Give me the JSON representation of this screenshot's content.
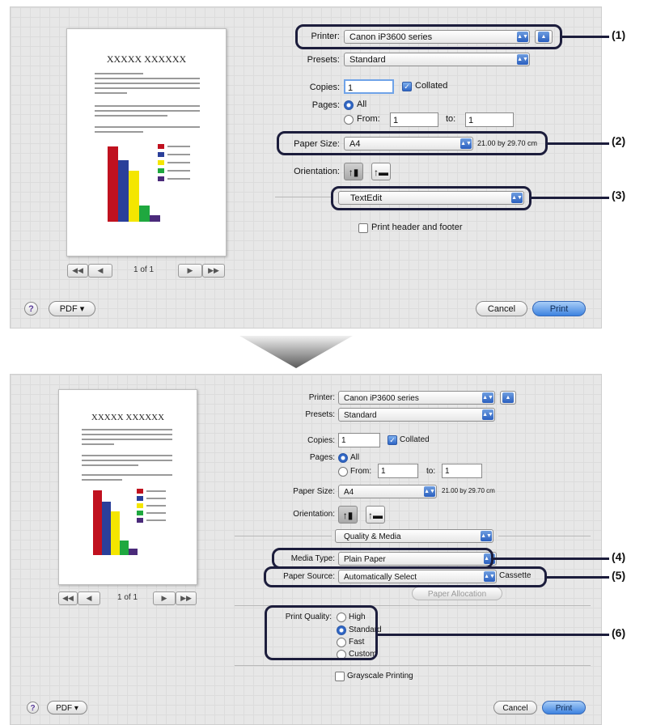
{
  "top": {
    "preview": {
      "doc_title": "XXXXX XXXXXX",
      "page_indicator": "1 of 1",
      "first_label": "◀◀",
      "prev_label": "◀",
      "next_label": "▶",
      "last_label": "▶▶"
    },
    "printer_label": "Printer:",
    "printer_value": "Canon iP3600 series",
    "presets_label": "Presets:",
    "presets_value": "Standard",
    "copies_label": "Copies:",
    "copies_value": "1",
    "collated_label": "Collated",
    "pages_label": "Pages:",
    "all_label": "All",
    "from_label": "From:",
    "from_value": "1",
    "to_label": "to:",
    "to_value": "1",
    "paper_size_label": "Paper Size:",
    "paper_size_value": "A4",
    "paper_dims": "21.00 by 29.70 cm",
    "orientation_label": "Orientation:",
    "panel_value": "TextEdit",
    "header_footer_label": "Print header and footer",
    "help_label": "?",
    "pdf_label": "PDF ▾",
    "cancel_label": "Cancel",
    "print_label": "Print"
  },
  "bottom": {
    "preview": {
      "doc_title": "XXXXX XXXXXX",
      "page_indicator": "1 of 1",
      "first_label": "◀◀",
      "prev_label": "◀",
      "next_label": "▶",
      "last_label": "▶▶"
    },
    "printer_label": "Printer:",
    "printer_value": "Canon iP3600 series",
    "presets_label": "Presets:",
    "presets_value": "Standard",
    "copies_label": "Copies:",
    "copies_value": "1",
    "collated_label": "Collated",
    "pages_label": "Pages:",
    "all_label": "All",
    "from_label": "From:",
    "from_value": "1",
    "to_label": "to:",
    "to_value": "1",
    "paper_size_label": "Paper Size:",
    "paper_size_value": "A4",
    "paper_dims": "21.00 by 29.70 cm",
    "orientation_label": "Orientation:",
    "panel_value": "Quality & Media",
    "media_type_label": "Media Type:",
    "media_type_value": "Plain Paper",
    "paper_source_label": "Paper Source:",
    "paper_source_value": "Automatically Select",
    "paper_source_extra": "Cassette",
    "paper_allocation_label": "Paper Allocation",
    "print_quality_label": "Print Quality:",
    "quality_options": [
      "High",
      "Standard",
      "Fast",
      "Custom"
    ],
    "grayscale_label": "Grayscale Printing",
    "help_label": "?",
    "pdf_label": "PDF ▾",
    "cancel_label": "Cancel",
    "print_label": "Print"
  },
  "callouts": [
    "(1)",
    "(2)",
    "(3)",
    "(4)",
    "(5)",
    "(6)"
  ],
  "colors": {
    "accent": "#1c1d3c",
    "chart_bars": [
      "#c0111f",
      "#2a3f9a",
      "#f4e600",
      "#1fa83f",
      "#4a2a7a"
    ]
  }
}
